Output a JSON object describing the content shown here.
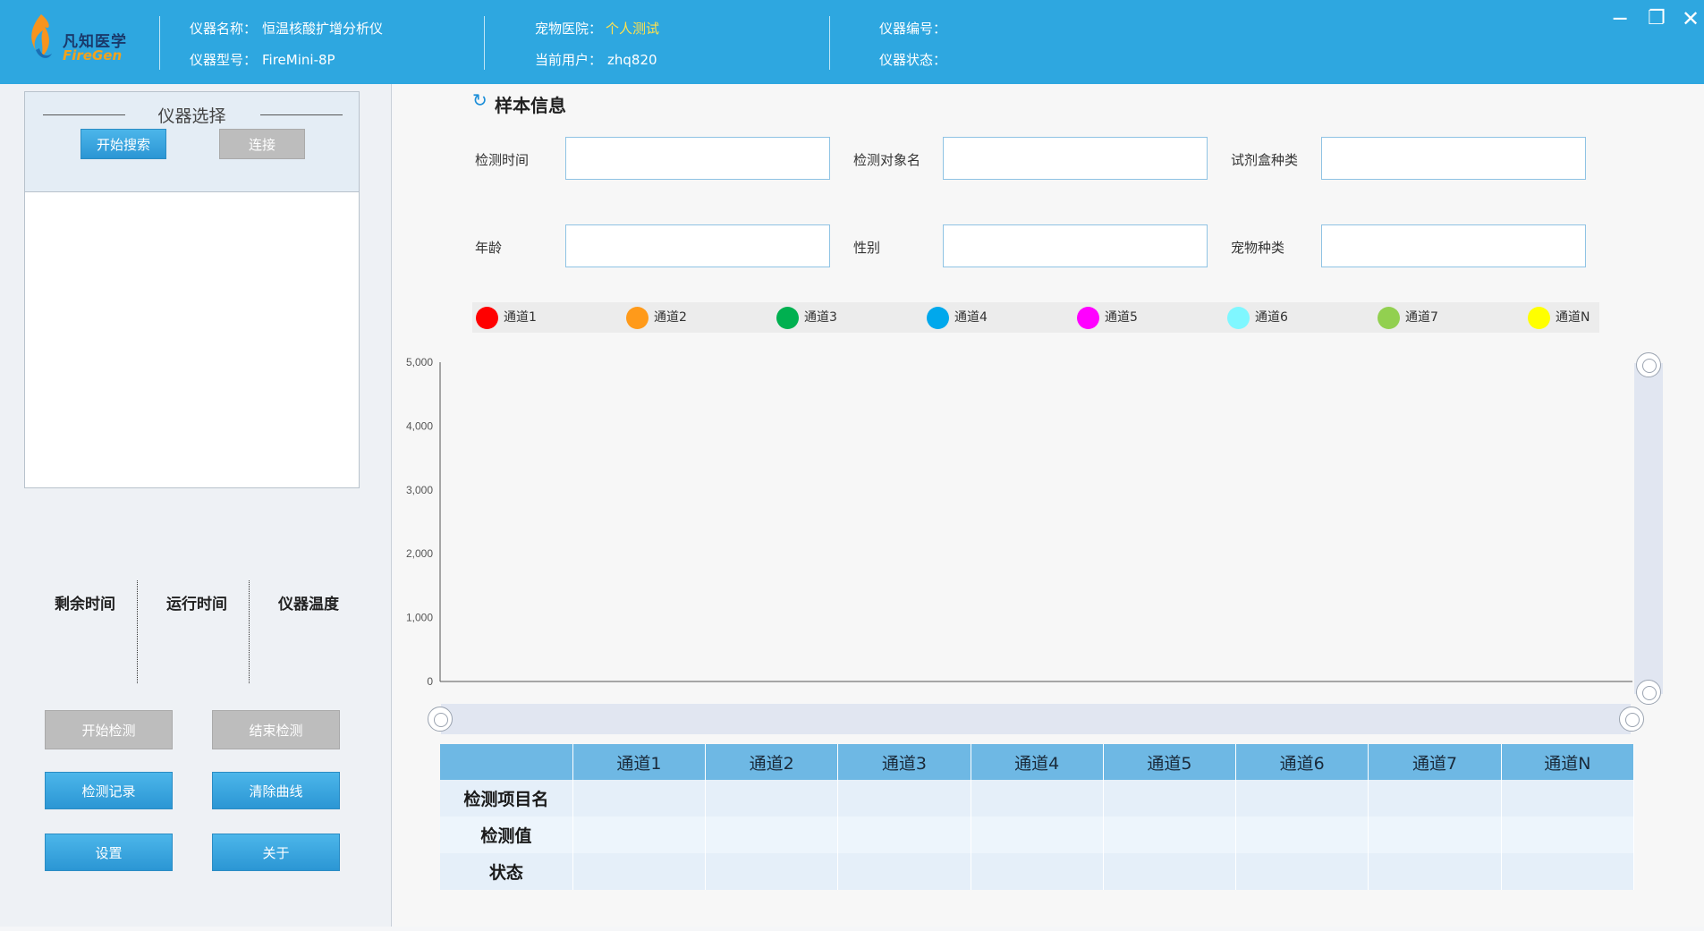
{
  "header": {
    "logo_cn": "凡知医学",
    "logo_en": "FireGen",
    "device_name_label": "仪器名称：",
    "device_name": "恒温核酸扩增分析仪",
    "device_model_label": "仪器型号：",
    "device_model": "FireMini-8P",
    "hospital_label": "宠物医院：",
    "hospital": "个人测试",
    "user_label": "当前用户：",
    "user": "zhq820",
    "device_no_label": "仪器编号：",
    "device_no": "",
    "device_status_label": "仪器状态：",
    "device_status": "",
    "minimize": "─",
    "maximize": "❐",
    "close": "✕"
  },
  "device_select": {
    "title": "仪器选择",
    "search_button": "开始搜索",
    "connect_button": "连接"
  },
  "stats": {
    "remaining": "剩余时间",
    "running": "运行时间",
    "temperature": "仪器温度"
  },
  "actions": {
    "start": "开始检测",
    "end": "结束检测",
    "records": "检测记录",
    "clear": "清除曲线",
    "settings": "设置",
    "about": "关于"
  },
  "sample": {
    "title": "样本信息",
    "refresh_icon": "↻",
    "fields": {
      "test_time": {
        "label": "检测时间",
        "value": ""
      },
      "subject_name": {
        "label": "检测对象名",
        "value": ""
      },
      "kit_type": {
        "label": "试剂盒种类",
        "value": ""
      },
      "age": {
        "label": "年龄",
        "value": ""
      },
      "sex": {
        "label": "性别",
        "value": ""
      },
      "pet_type": {
        "label": "宠物种类",
        "value": ""
      }
    }
  },
  "legend": [
    {
      "label": "通道1",
      "color": "#ff0000"
    },
    {
      "label": "通道2",
      "color": "#ff9a1a"
    },
    {
      "label": "通道3",
      "color": "#00b050"
    },
    {
      "label": "通道4",
      "color": "#00a8ec"
    },
    {
      "label": "通道5",
      "color": "#ff00ff"
    },
    {
      "label": "通道6",
      "color": "#7ff7ff"
    },
    {
      "label": "通道7",
      "color": "#92d050"
    },
    {
      "label": "通道N",
      "color": "#ffff00"
    }
  ],
  "chart_data": {
    "type": "line",
    "title": "",
    "xlabel": "",
    "ylabel": "",
    "ylim": [
      0,
      5000
    ],
    "yticks": [
      "0",
      "1,000",
      "2,000",
      "3,000",
      "4,000",
      "5,000"
    ],
    "grid": false,
    "series": []
  },
  "table": {
    "columns": [
      "",
      "通道1",
      "通道2",
      "通道3",
      "通道4",
      "通道5",
      "通道6",
      "通道7",
      "通道N"
    ],
    "rows": [
      {
        "label": "检测项目名",
        "cells": [
          "",
          "",
          "",
          "",
          "",
          "",
          "",
          ""
        ]
      },
      {
        "label": "检测值",
        "cells": [
          "",
          "",
          "",
          "",
          "",
          "",
          "",
          ""
        ]
      },
      {
        "label": "状态",
        "cells": [
          "",
          "",
          "",
          "",
          "",
          "",
          "",
          ""
        ]
      }
    ]
  }
}
